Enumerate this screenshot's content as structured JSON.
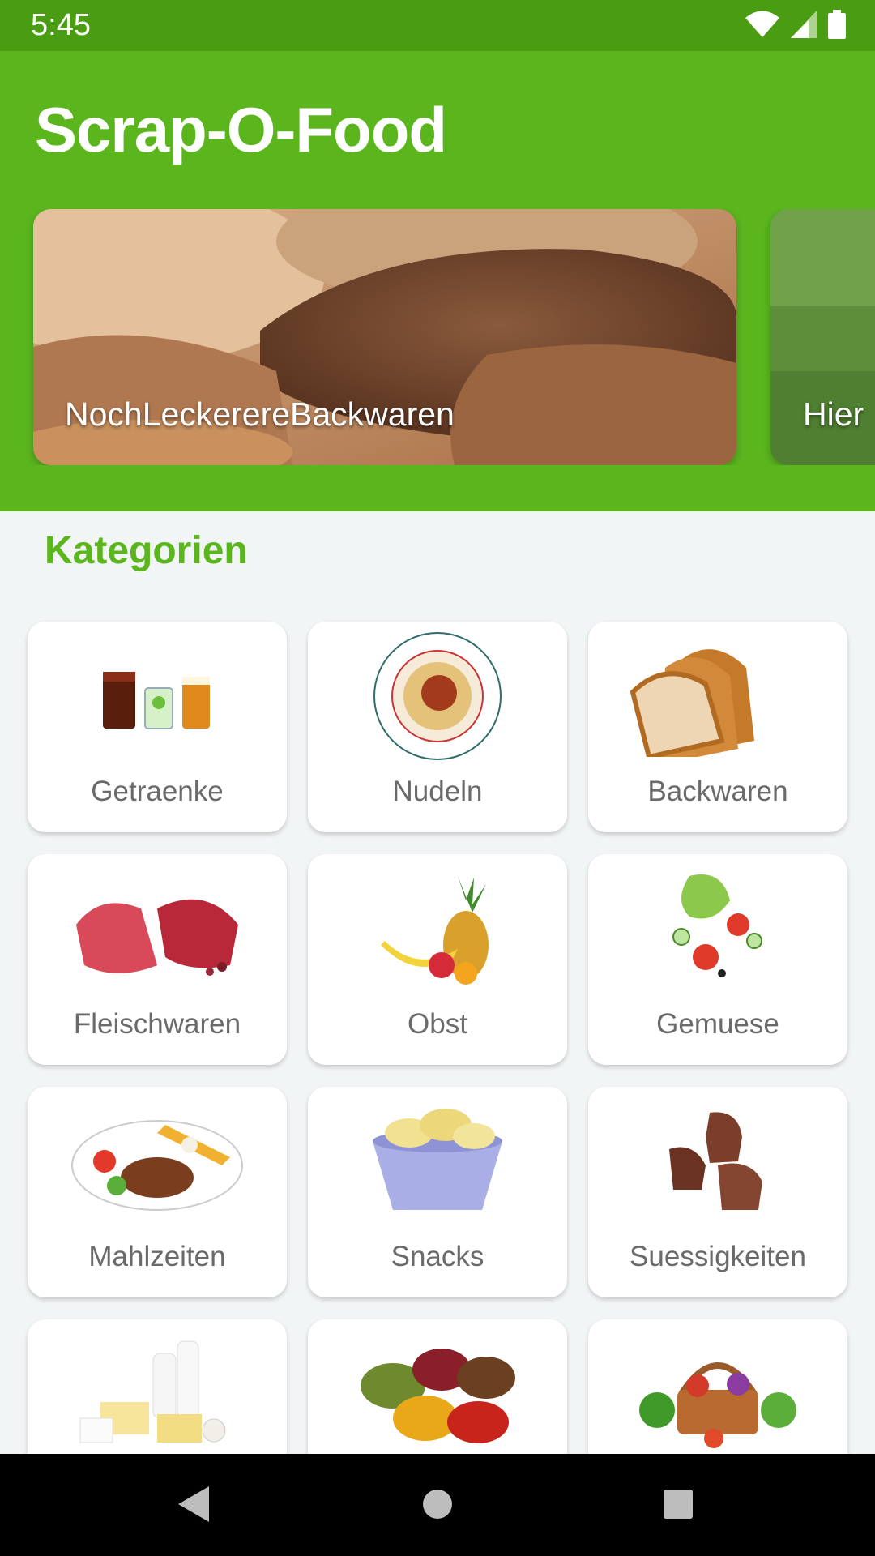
{
  "status_bar": {
    "time": "5:45"
  },
  "app": {
    "title": "Scrap-O-Food"
  },
  "banners": [
    {
      "label": "NochLeckerereBackwaren"
    },
    {
      "label": "Hier"
    }
  ],
  "categories_title": "Kategorien",
  "categories": [
    {
      "label": "Getraenke",
      "icon": "drinks-icon"
    },
    {
      "label": "Nudeln",
      "icon": "pasta-icon"
    },
    {
      "label": "Backwaren",
      "icon": "bread-icon"
    },
    {
      "label": "Fleischwaren",
      "icon": "meat-icon"
    },
    {
      "label": "Obst",
      "icon": "fruit-icon"
    },
    {
      "label": "Gemuese",
      "icon": "vegetables-icon"
    },
    {
      "label": "Mahlzeiten",
      "icon": "meal-icon"
    },
    {
      "label": "Snacks",
      "icon": "chips-icon"
    },
    {
      "label": "Suessigkeiten",
      "icon": "chocolate-icon"
    },
    {
      "label": "",
      "icon": "dairy-icon"
    },
    {
      "label": "",
      "icon": "spices-icon"
    },
    {
      "label": "",
      "icon": "basket-icon"
    }
  ],
  "colors": {
    "primary": "#5bb61e",
    "status_bar": "#4a9c12",
    "background": "#f2f5f6"
  }
}
